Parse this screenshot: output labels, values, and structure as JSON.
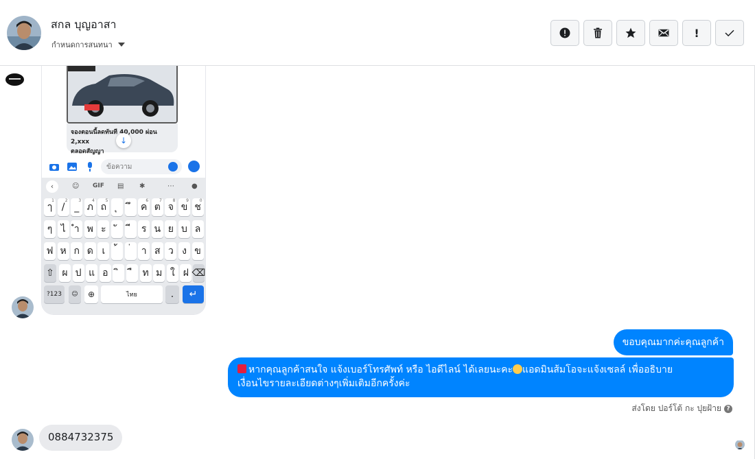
{
  "header": {
    "contact_name": "สกล บุญอาสา",
    "assign_label": "กำหนดการสนทนา",
    "actions": [
      {
        "name": "spam-button",
        "icon": "alert-circle-icon"
      },
      {
        "name": "delete-button",
        "icon": "trash-icon"
      },
      {
        "name": "star-button",
        "icon": "star-icon"
      },
      {
        "name": "mark-unread-button",
        "icon": "envelope-icon"
      },
      {
        "name": "follow-up-button",
        "icon": "exclamation-icon",
        "text": "!"
      },
      {
        "name": "done-button",
        "icon": "check-icon"
      }
    ]
  },
  "shared_screenshot": {
    "caption_line1": "จองตอนนี้ลดทันที 40,000 ผ่อน 2,xxx",
    "caption_line2": "ตลอดสัญญา",
    "input_placeholder": "ข้อความ",
    "keyboard_tools": [
      "GIF"
    ],
    "row1": [
      "ๅ",
      "/",
      "_",
      "ภ",
      "ถ",
      "ุ",
      "ึ",
      "ค",
      "ต",
      "จ",
      "ข",
      "ช"
    ],
    "row2": [
      "ๆ",
      "ไ",
      "ำ",
      "พ",
      "ะ",
      "ั",
      "ี",
      "ร",
      "น",
      "ย",
      "บ",
      "ล"
    ],
    "row3": [
      "ฟ",
      "ห",
      "ก",
      "ด",
      "เ",
      "้",
      "่",
      "า",
      "ส",
      "ว",
      "ง",
      "ข"
    ],
    "row4": [
      "ผ",
      "ป",
      "แ",
      "อ",
      "ิ",
      "ื",
      "ท",
      "ม",
      "ใ",
      "ฝ"
    ],
    "key_numbers": "?123",
    "key_space": "ไทย",
    "key_dot": ".",
    "row1_hints": [
      "1",
      "2",
      "3",
      "4",
      "5",
      "",
      "",
      "6",
      "7",
      "8",
      "9",
      "0"
    ]
  },
  "messages": {
    "out_1": "ขอบคุณมากค่ะคุณลูกค้า",
    "out_2_line1": "หากคุณลูกค้าสนใจ แจ้งเบอร์โทรศัพท์ หรือ ไอดีไลน์  ได้เลยนะคะ",
    "out_2_line1b": "แอดมินส้มโอจะแจ้งเซลล์   เพื่ออธิบาย",
    "out_2_line2": "เงื่อนไขรายละเอียดต่างๆเพิ่มเติมอีกครั้งค่ะ",
    "sent_by": "ส่งโดย ปอร์โต้ กะ ปุยฝ้าย",
    "in_phone": "0884732375"
  },
  "colors": {
    "outgoing_bubble": "#0084ff",
    "incoming_bubble": "#e9eaed",
    "keyboard_accent": "#1a73e8"
  }
}
